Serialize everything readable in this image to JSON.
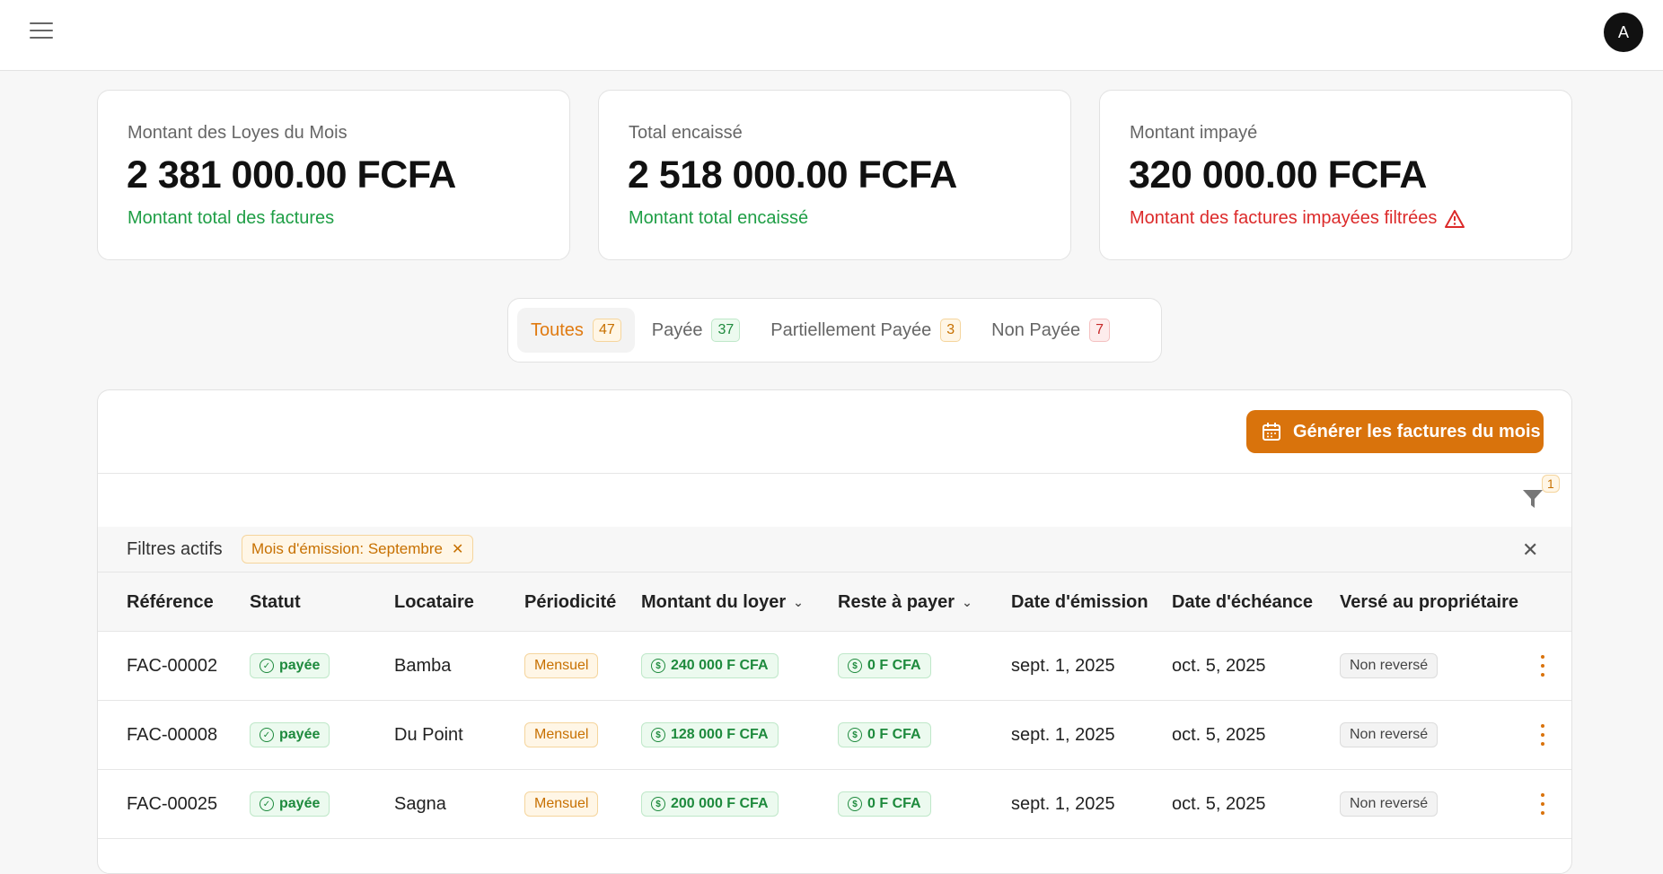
{
  "header": {
    "avatar_letter": "A"
  },
  "cards": [
    {
      "title": "Montant des Loyes du Mois",
      "value": "2 381 000.00 FCFA",
      "subtitle": "Montant total des factures"
    },
    {
      "title": "Total encaissé",
      "value": "2 518 000.00 FCFA",
      "subtitle": "Montant total encaissé"
    },
    {
      "title": "Montant impayé",
      "value": "320 000.00 FCFA",
      "subtitle": "Montant des factures impayées filtrées"
    }
  ],
  "tabs": [
    {
      "label": "Toutes",
      "count": "47"
    },
    {
      "label": "Payée",
      "count": "37"
    },
    {
      "label": "Partiellement Payée",
      "count": "3"
    },
    {
      "label": "Non Payée",
      "count": "7"
    }
  ],
  "toolbar": {
    "generate_label": "Générer les factures du mois",
    "filter_count": "1"
  },
  "filters": {
    "label": "Filtres actifs",
    "chip": "Mois d'émission: Septembre"
  },
  "table": {
    "headers": {
      "reference": "Référence",
      "status": "Statut",
      "tenant": "Locataire",
      "periodicity": "Périodicité",
      "rent": "Montant du loyer",
      "remaining": "Reste à payer",
      "issue_date": "Date d'émission",
      "due_date": "Date d'échéance",
      "paid_owner": "Versé au propriétaire"
    },
    "rows": [
      {
        "reference": "FAC-00002",
        "status": "payée",
        "tenant": "Bamba",
        "periodicity": "Mensuel",
        "rent": "240 000 F CFA",
        "remaining": "0 F CFA",
        "issue_date": "sept. 1, 2025",
        "due_date": "oct. 5, 2025",
        "paid_owner": "Non reversé"
      },
      {
        "reference": "FAC-00008",
        "status": "payée",
        "tenant": "Du Point",
        "periodicity": "Mensuel",
        "rent": "128 000 F CFA",
        "remaining": "0 F CFA",
        "issue_date": "sept. 1, 2025",
        "due_date": "oct. 5, 2025",
        "paid_owner": "Non reversé"
      },
      {
        "reference": "FAC-00025",
        "status": "payée",
        "tenant": "Sagna",
        "periodicity": "Mensuel",
        "rent": "200 000 F CFA",
        "remaining": "0 F CFA",
        "issue_date": "sept. 1, 2025",
        "due_date": "oct. 5, 2025",
        "paid_owner": "Non reversé"
      }
    ]
  }
}
